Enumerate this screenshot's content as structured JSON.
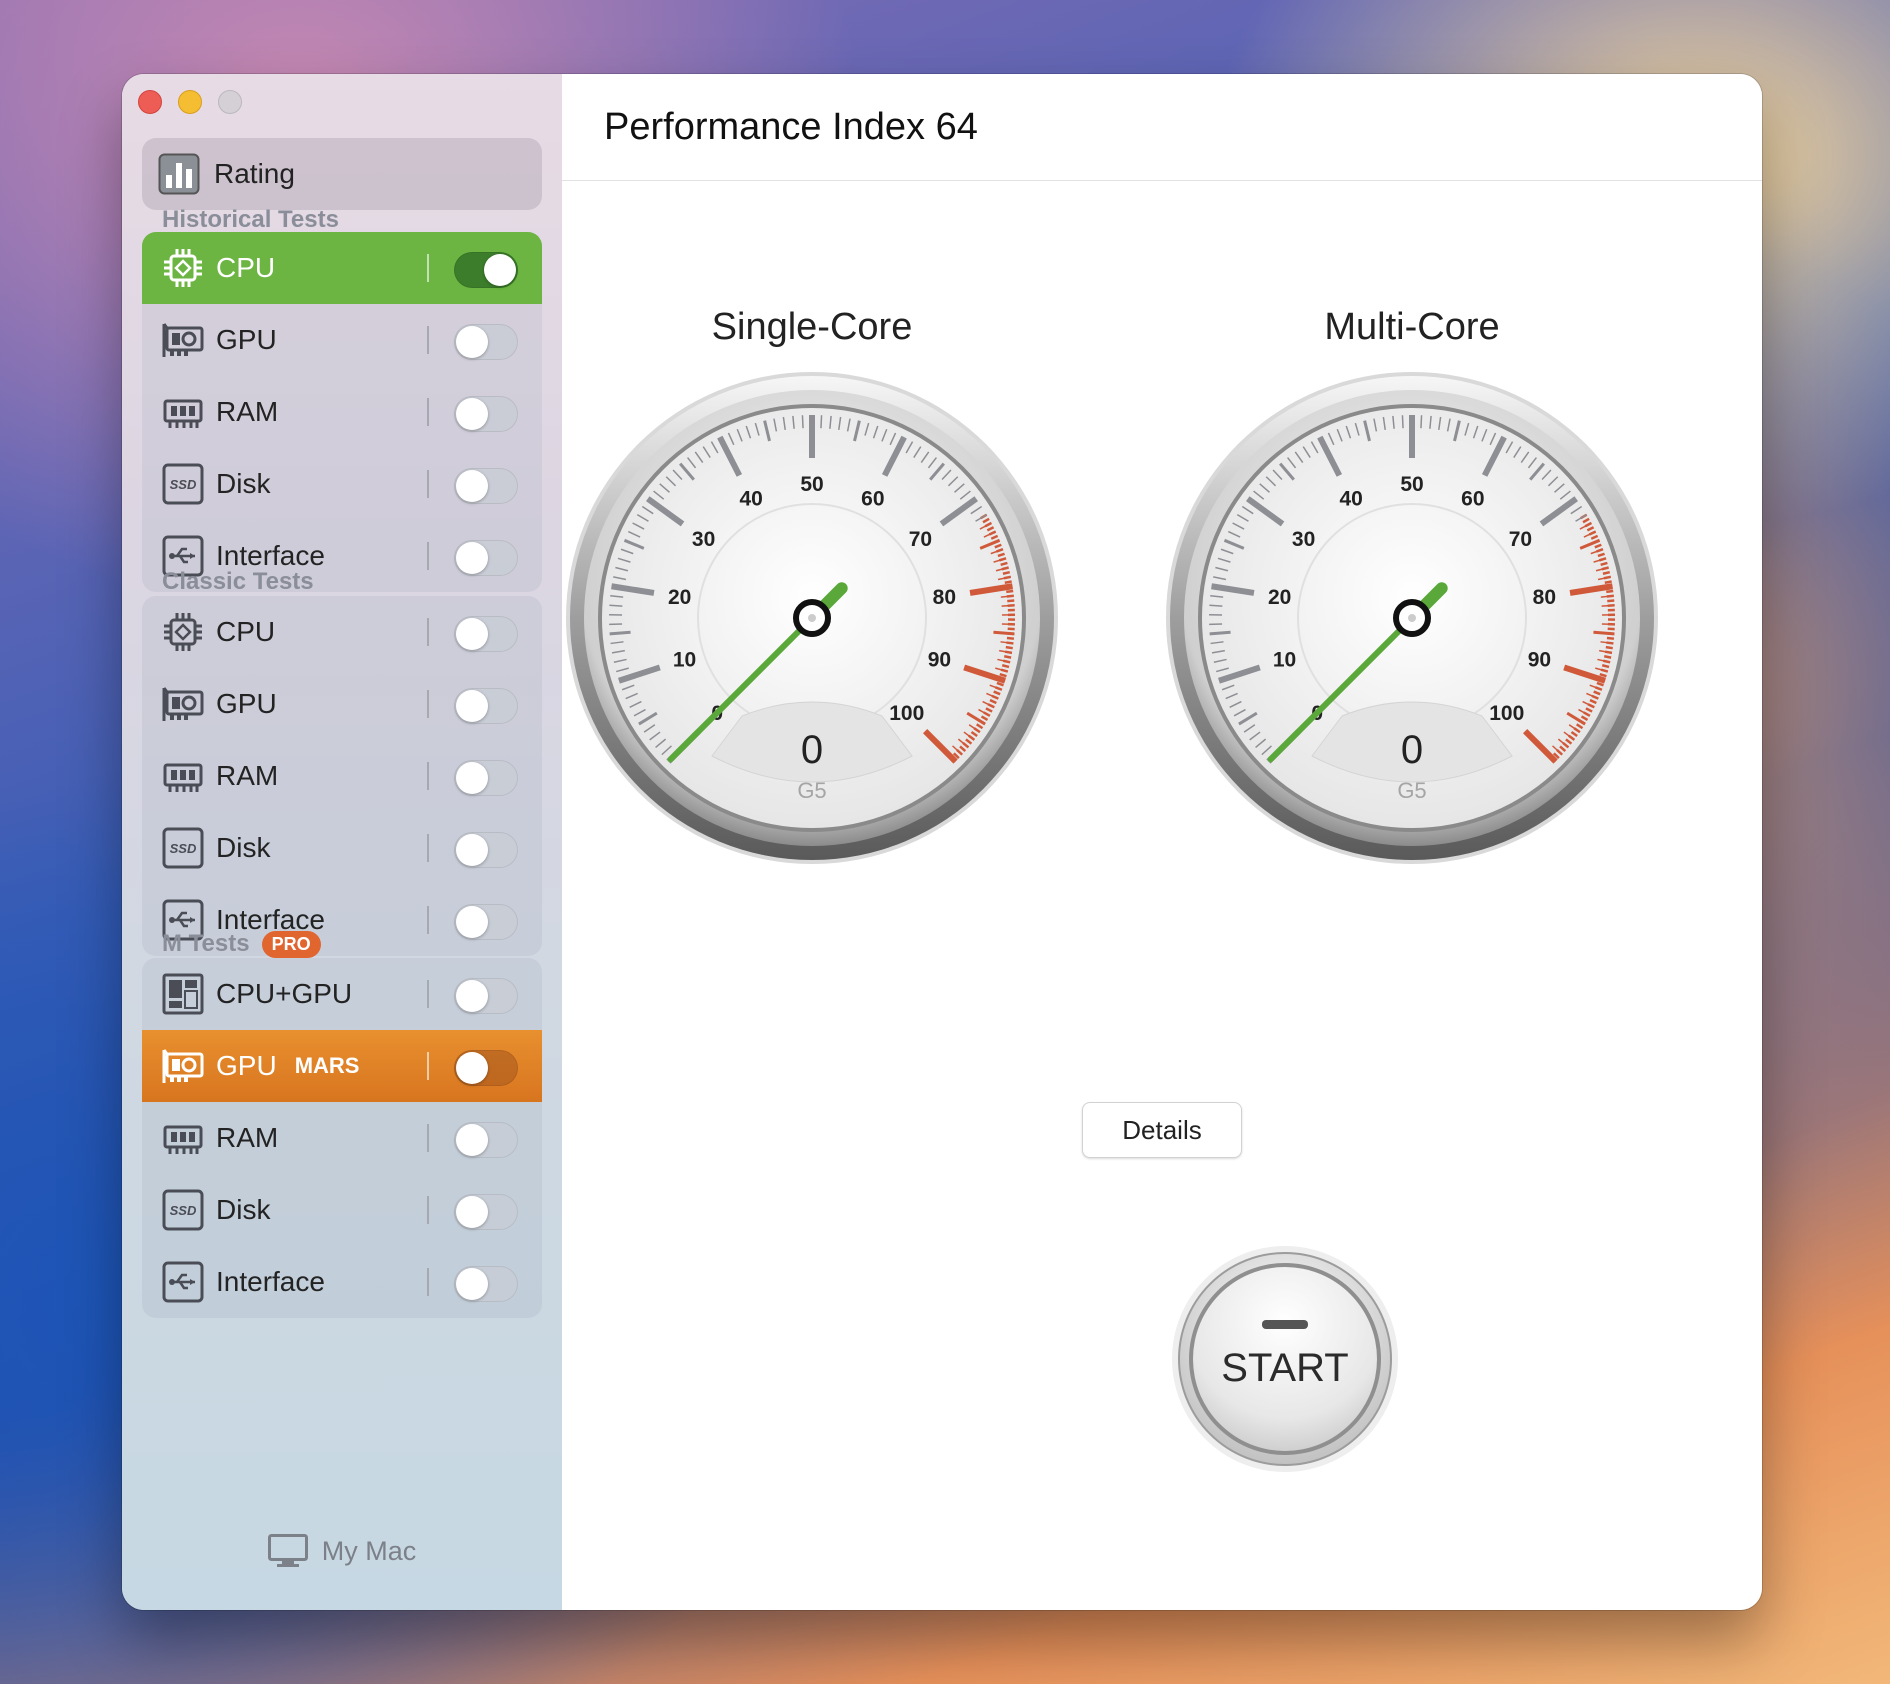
{
  "header": {
    "title": "Performance Index 64"
  },
  "sidebar": {
    "rating_label": "Rating",
    "sections": [
      {
        "title": "Historical Tests",
        "badge": "",
        "items": [
          {
            "icon": "cpu-icon",
            "label": "CPU",
            "on": true,
            "selected": true
          },
          {
            "icon": "gpu-icon",
            "label": "GPU",
            "on": false
          },
          {
            "icon": "ram-icon",
            "label": "RAM",
            "on": false
          },
          {
            "icon": "ssd-icon",
            "label": "Disk",
            "on": false
          },
          {
            "icon": "usb-icon",
            "label": "Interface",
            "on": false
          }
        ]
      },
      {
        "title": "Classic Tests",
        "badge": "",
        "items": [
          {
            "icon": "cpu-icon",
            "label": "CPU",
            "on": false
          },
          {
            "icon": "gpu-icon",
            "label": "GPU",
            "on": false
          },
          {
            "icon": "ram-icon",
            "label": "RAM",
            "on": false
          },
          {
            "icon": "ssd-icon",
            "label": "Disk",
            "on": false
          },
          {
            "icon": "usb-icon",
            "label": "Interface",
            "on": false
          }
        ]
      },
      {
        "title": "M Tests",
        "badge": "PRO",
        "items": [
          {
            "icon": "cpu-gpu-icon",
            "label": "CPU+GPU",
            "on": false
          },
          {
            "icon": "gpu-icon",
            "label": "GPU",
            "badge": "MARS",
            "on": false,
            "selected": true
          },
          {
            "icon": "ram-icon",
            "label": "RAM",
            "on": false
          },
          {
            "icon": "ssd-icon",
            "label": "Disk",
            "on": false
          },
          {
            "icon": "usb-icon",
            "label": "Interface",
            "on": false
          }
        ]
      }
    ],
    "footer_label": "My Mac"
  },
  "gauges": [
    {
      "title": "Single-Core",
      "value": "0",
      "unit": "G5",
      "ticks": [
        "0",
        "10",
        "20",
        "30",
        "40",
        "50",
        "60",
        "70",
        "80",
        "90",
        "100"
      ]
    },
    {
      "title": "Multi-Core",
      "value": "0",
      "unit": "G5",
      "ticks": [
        "0",
        "10",
        "20",
        "30",
        "40",
        "50",
        "60",
        "70",
        "80",
        "90",
        "100"
      ]
    }
  ],
  "buttons": {
    "details": "Details",
    "start": "START"
  },
  "colors": {
    "selected_green": "#6cb542",
    "selected_orange": "#e0852a",
    "redline": "#d0593a",
    "needle": "#5aa83a"
  }
}
